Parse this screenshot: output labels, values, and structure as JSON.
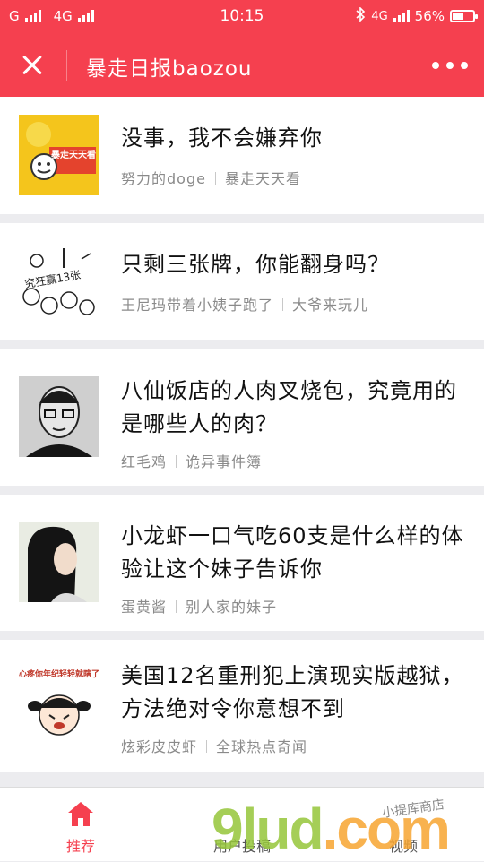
{
  "status_bar": {
    "carrier_left": "G",
    "network": "4G",
    "time": "10:15",
    "network_right": "4G",
    "battery": "56%",
    "battery_level": 0.56
  },
  "header": {
    "title": "暴走日报baozou"
  },
  "feed": [
    {
      "title": "没事，我不会嫌弃你",
      "author": "努力的doge",
      "column": "暴走天天看",
      "thumb_text": "暴走天天看"
    },
    {
      "title": "只剩三张牌，你能翻身吗？",
      "author": "王尼玛带着小姨子跑了",
      "column": "大爷来玩儿",
      "thumb_text": "究狂赢13张"
    },
    {
      "title": "八仙饭店的人肉叉烧包，究竟用的是哪些人的肉？",
      "author": "红毛鸡",
      "column": "诡异事件簿",
      "thumb_text": ""
    },
    {
      "title": "小龙虾一口气吃60支是什么样的体验让这个妹子告诉你",
      "author": "蛋黄酱",
      "column": "别人家的妹子",
      "thumb_text": ""
    },
    {
      "title": "美国12名重刑犯上演现实版越狱，方法绝对令你意想不到",
      "author": "炫彩皮皮虾",
      "column": "全球热点奇闻",
      "thumb_text": "心疼你年纪轻轻就瞎了"
    }
  ],
  "tabs": [
    {
      "label": "推荐",
      "active": true
    },
    {
      "label": "用户投稿",
      "active": false
    },
    {
      "label": "视频",
      "active": false
    }
  ],
  "watermark": {
    "brand_a": "9lud",
    "brand_b": ".com",
    "shop": "小提库商店"
  },
  "colors": {
    "accent": "#f5404f",
    "background": "#ececef",
    "meta_text": "#8a8a8a"
  }
}
